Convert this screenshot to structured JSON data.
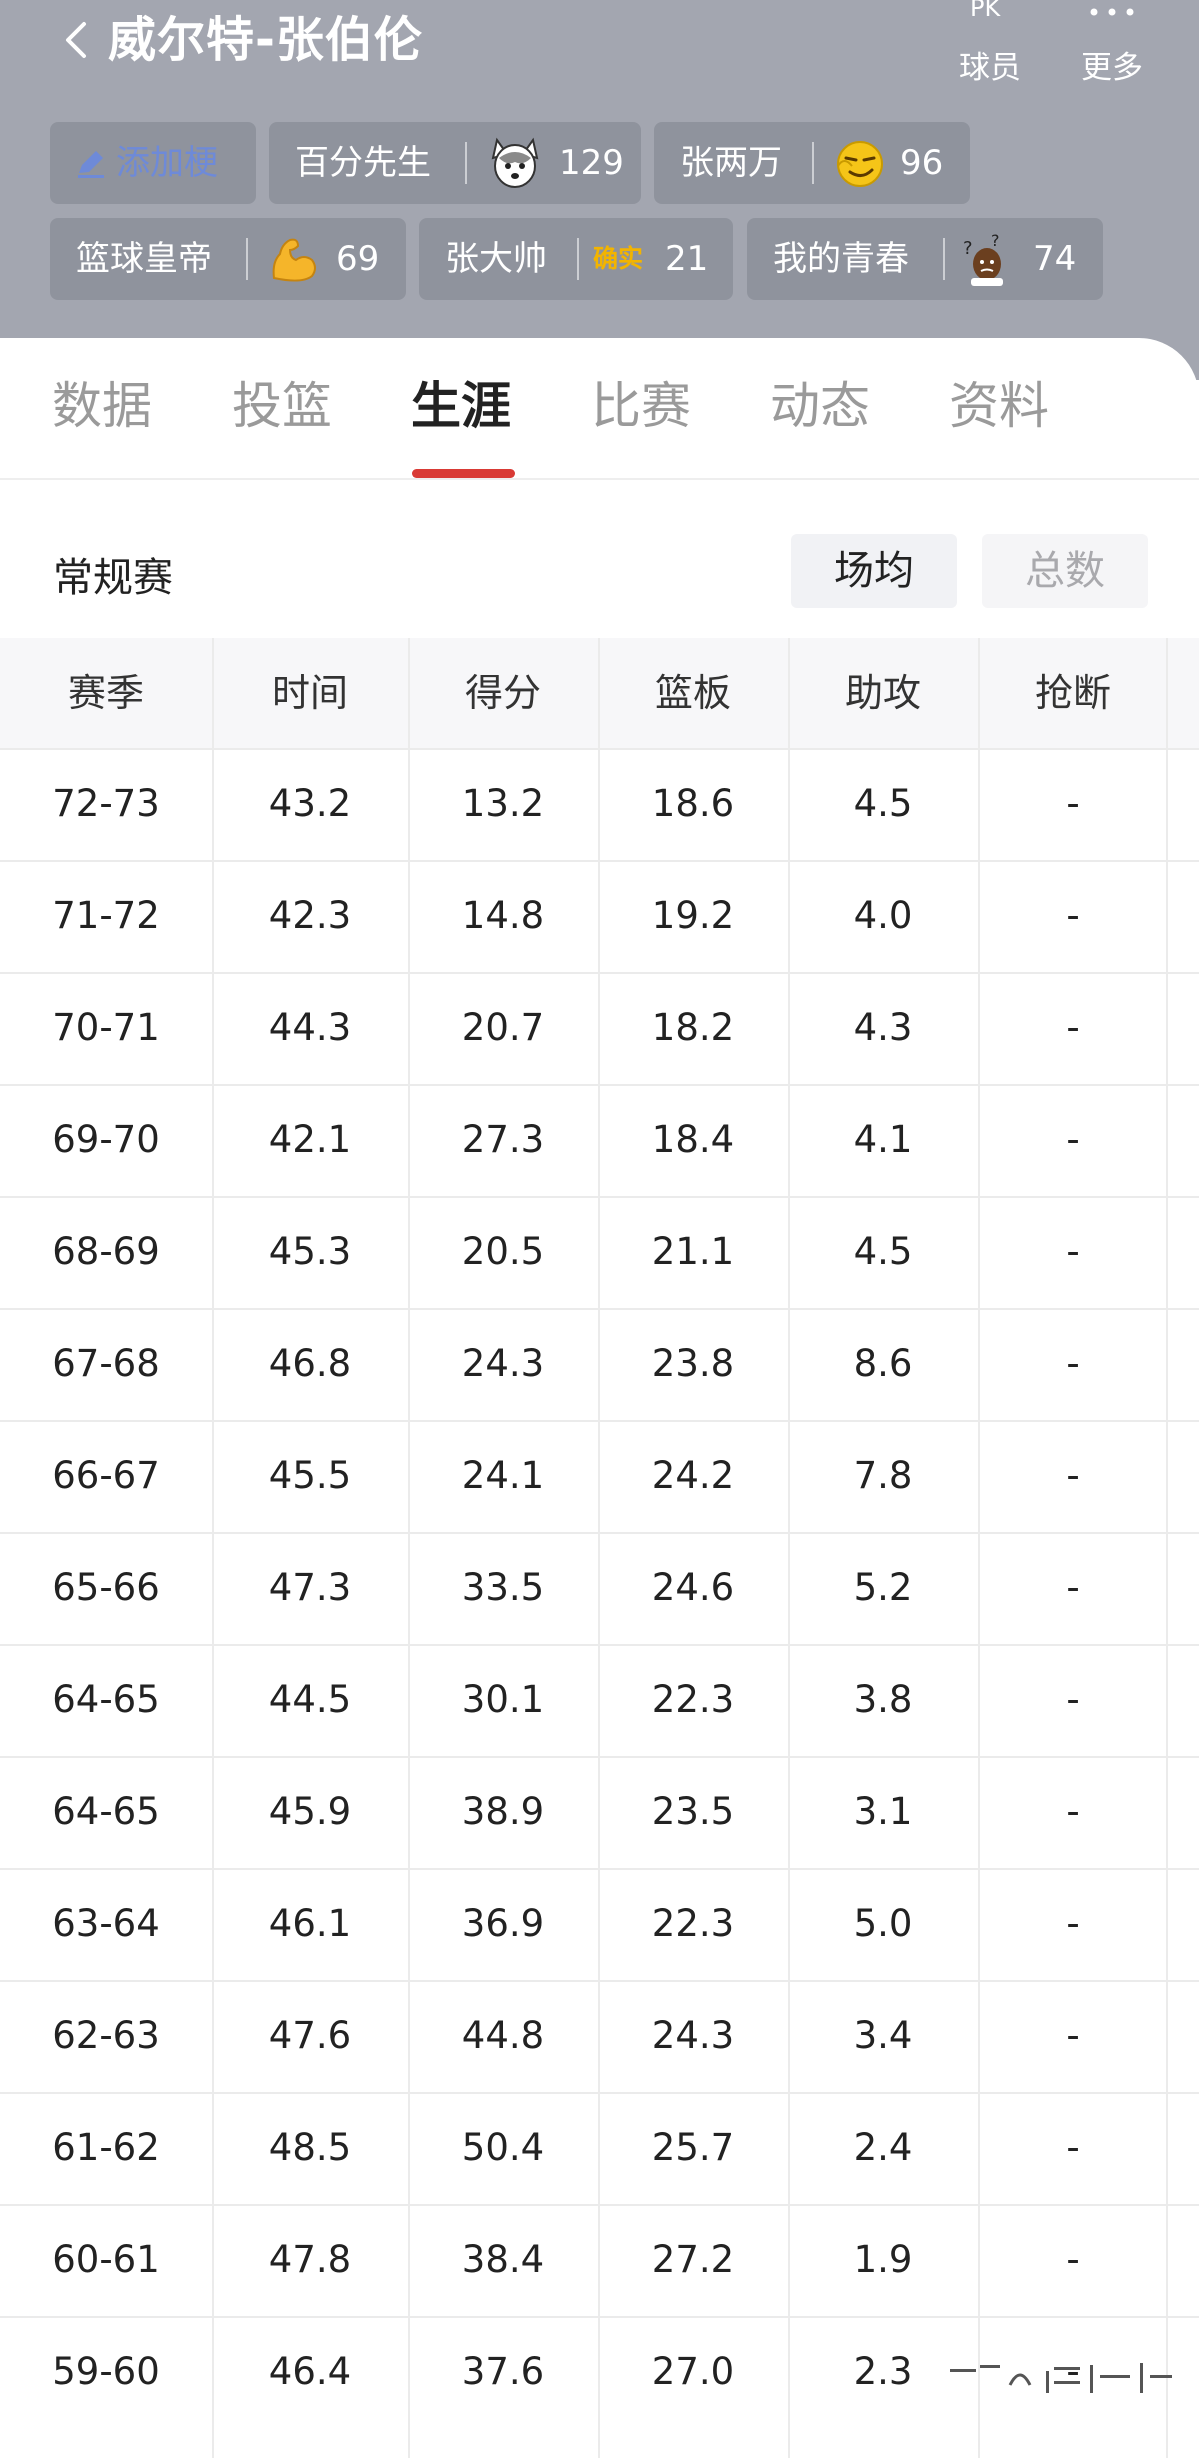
{
  "header": {
    "title": "威尔特-张伯伦",
    "pk_label": "球员",
    "more_label": "更多",
    "pk_icon_text": "PK"
  },
  "tags": {
    "add_label": "添加梗",
    "chips": [
      {
        "name": "百分先生",
        "emoji": "husky-face-icon",
        "count": "129"
      },
      {
        "name": "张两万",
        "emoji": "smirk-face-icon",
        "count": "96"
      },
      {
        "name": "篮球皇帝",
        "emoji": "flexed-biceps-icon",
        "count": "69"
      },
      {
        "name": "张大帅",
        "emoji": "queshi-stamp-icon",
        "emoji_text": "确实",
        "count": "21"
      },
      {
        "name": "我的青春",
        "emoji": "confused-man-icon",
        "count": "74"
      }
    ]
  },
  "tabs": [
    {
      "label": "数据",
      "active": false
    },
    {
      "label": "投篮",
      "active": false
    },
    {
      "label": "生涯",
      "active": true
    },
    {
      "label": "比赛",
      "active": false
    },
    {
      "label": "动态",
      "active": false
    },
    {
      "label": "资料",
      "active": false
    }
  ],
  "section": {
    "title": "常规赛",
    "toggle_avg": "场均",
    "toggle_total": "总数"
  },
  "table": {
    "columns": [
      "赛季",
      "时间",
      "得分",
      "篮板",
      "助攻",
      "抢断"
    ],
    "rows": [
      [
        "72-73",
        "43.2",
        "13.2",
        "18.6",
        "4.5",
        "-"
      ],
      [
        "71-72",
        "42.3",
        "14.8",
        "19.2",
        "4.0",
        "-"
      ],
      [
        "70-71",
        "44.3",
        "20.7",
        "18.2",
        "4.3",
        "-"
      ],
      [
        "69-70",
        "42.1",
        "27.3",
        "18.4",
        "4.1",
        "-"
      ],
      [
        "68-69",
        "45.3",
        "20.5",
        "21.1",
        "4.5",
        "-"
      ],
      [
        "67-68",
        "46.8",
        "24.3",
        "23.8",
        "8.6",
        "-"
      ],
      [
        "66-67",
        "45.5",
        "24.1",
        "24.2",
        "7.8",
        "-"
      ],
      [
        "65-66",
        "47.3",
        "33.5",
        "24.6",
        "5.2",
        "-"
      ],
      [
        "64-65",
        "44.5",
        "30.1",
        "22.3",
        "3.8",
        "-"
      ],
      [
        "64-65",
        "45.9",
        "38.9",
        "23.5",
        "3.1",
        "-"
      ],
      [
        "63-64",
        "46.1",
        "36.9",
        "22.3",
        "5.0",
        "-"
      ],
      [
        "62-63",
        "47.6",
        "44.8",
        "24.3",
        "3.4",
        "-"
      ],
      [
        "61-62",
        "48.5",
        "50.4",
        "25.7",
        "2.4",
        "-"
      ],
      [
        "60-61",
        "47.8",
        "38.4",
        "27.2",
        "1.9",
        "-"
      ],
      [
        "59-60",
        "46.4",
        "37.6",
        "27.0",
        "2.3",
        "-"
      ]
    ]
  },
  "colors": {
    "header_bg": "#a3a6b0",
    "chip_bg": "#8f939d",
    "accent": "#d93a35",
    "add_tag_blue": "#6e8ad8"
  }
}
